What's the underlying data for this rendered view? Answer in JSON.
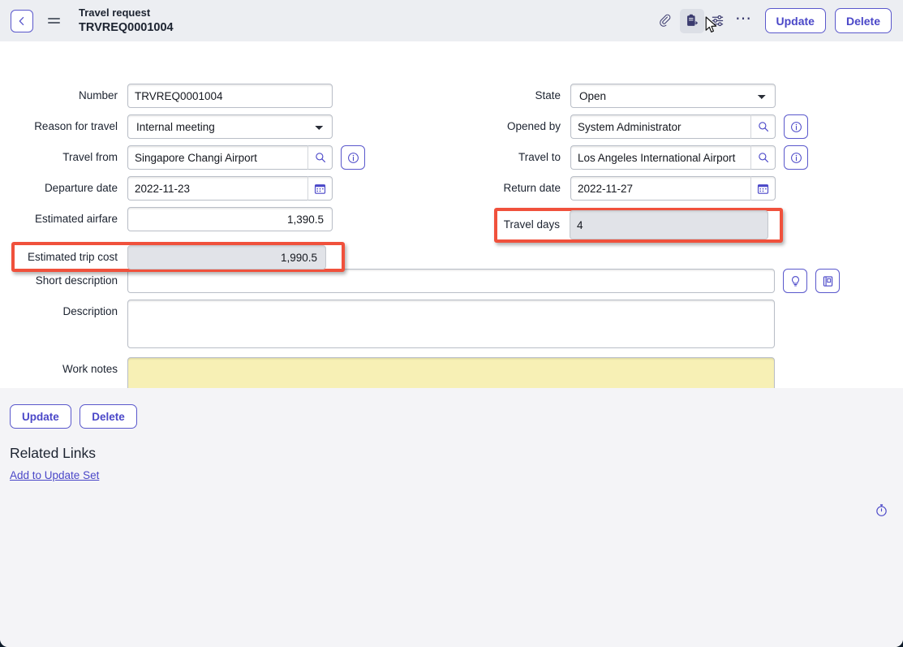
{
  "header": {
    "back_icon": "chevron-left-icon",
    "menu_icon": "hamburger-icon",
    "title": "Travel request",
    "record_number": "TRVREQ0001004",
    "icons": [
      {
        "name": "attachment-icon",
        "label": "Attachments"
      },
      {
        "name": "template-icon",
        "label": "Templates"
      },
      {
        "name": "personalize-form-icon",
        "label": "Personalize Form"
      },
      {
        "name": "more-options-icon",
        "label": "..."
      }
    ],
    "update_label": "Update",
    "delete_label": "Delete"
  },
  "form": {
    "left": {
      "number": {
        "label": "Number",
        "value": "TRVREQ0001004"
      },
      "reason": {
        "label": "Reason for travel",
        "value": "Internal meeting"
      },
      "travel_from": {
        "label": "Travel from",
        "value": "Singapore Changi Airport"
      },
      "departure_date": {
        "label": "Departure date",
        "value": "2022-11-23"
      },
      "estimated_airfare": {
        "label": "Estimated airfare",
        "value": "1,390.5"
      },
      "estimated_trip_cost": {
        "label": "Estimated trip cost",
        "value": "1,990.5"
      }
    },
    "right": {
      "state": {
        "label": "State",
        "value": "Open"
      },
      "opened_by": {
        "label": "Opened by",
        "value": "System Administrator"
      },
      "travel_to": {
        "label": "Travel to",
        "value": "Los Angeles International Airport"
      },
      "return_date": {
        "label": "Return date",
        "value": "2022-11-27"
      },
      "travel_days": {
        "label": "Travel days",
        "value": "4"
      }
    },
    "wide": {
      "short_description": {
        "label": "Short description",
        "value": ""
      },
      "description": {
        "label": "Description",
        "value": ""
      },
      "work_notes": {
        "label": "Work notes",
        "value": ""
      }
    }
  },
  "bottom": {
    "update_label": "Update",
    "delete_label": "Delete",
    "related_links_title": "Related Links",
    "add_to_update_set": "Add to Update Set",
    "stopwatch_icon": "stopwatch-icon"
  },
  "annotations": {
    "highlight_color": "#f0513c",
    "highlighted_fields": [
      "Estimated trip cost",
      "Travel days"
    ]
  },
  "colors": {
    "accent": "#4a47c8",
    "header_bg": "#eceef2",
    "page_bg": "#f4f4f7",
    "worknotes_bg": "#f7f0b5",
    "readonly_bg": "#e1e3e8"
  }
}
